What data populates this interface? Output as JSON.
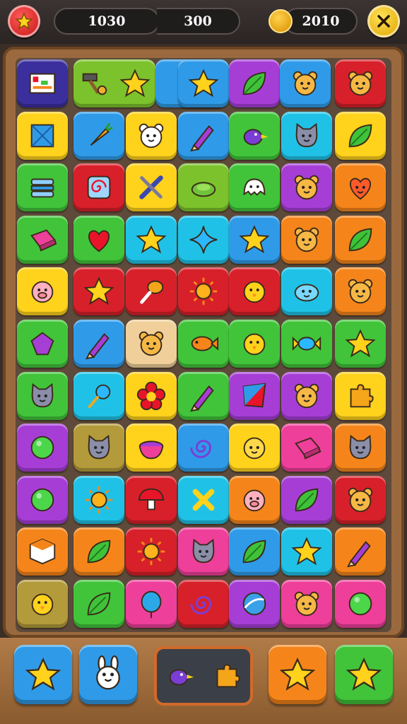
{
  "hud": {
    "score": "1030",
    "moves": "300",
    "coins": "2010",
    "star_button": "star-icon",
    "close_button": "close-icon"
  },
  "colors": {
    "navy": "#3b2f9e",
    "lime": "#7cc22c",
    "blue": "#2f9be8",
    "purple": "#a63ed6",
    "red": "#d8202a",
    "yellow": "#ffd21c",
    "orange": "#f5851a",
    "green": "#41c43a",
    "cyan": "#1fc2e6",
    "pink": "#ee3f9a",
    "olive": "#b39a3a",
    "tan": "#f0cf9a"
  },
  "grid": {
    "rows": [
      [
        [
          "navy",
          "toy-box-icon"
        ],
        [
          "lime",
          "hammer-icon"
        ],
        [
          "lime",
          "star-icon"
        ],
        [
          "blue",
          "cherry-icon"
        ],
        [
          "blue",
          "star-icon"
        ],
        [
          "purple",
          "leaf-icon"
        ],
        [
          "blue",
          "bear-icon"
        ],
        [
          "red",
          "bear-icon"
        ]
      ],
      [
        [
          "yellow",
          "box-icon"
        ],
        [
          "blue",
          "carrot-icon"
        ],
        [
          "yellow",
          "polar-bear-icon"
        ],
        [
          "blue",
          "crayon-icon"
        ],
        [
          "green",
          "bird-icon"
        ],
        [
          "cyan",
          "cat-icon"
        ],
        [
          "yellow",
          "leaf-icon"
        ]
      ],
      [
        [
          "green",
          "sandwich-icon"
        ],
        [
          "red",
          "swirl-candy-icon"
        ],
        [
          "yellow",
          "wrench-icon"
        ],
        [
          "lime",
          "turtle-icon"
        ],
        [
          "green",
          "ghost-icon"
        ],
        [
          "purple",
          "bear-icon"
        ],
        [
          "orange",
          "heart-face-icon"
        ]
      ],
      [
        [
          "green",
          "eraser-icon"
        ],
        [
          "green",
          "heart-icon"
        ],
        [
          "cyan",
          "star-icon"
        ],
        [
          "cyan",
          "sparkle-icon"
        ],
        [
          "blue",
          "star-icon"
        ],
        [
          "orange",
          "bear-icon"
        ],
        [
          "orange",
          "leaf-icon"
        ]
      ],
      [
        [
          "yellow",
          "pig-icon"
        ],
        [
          "red",
          "star-icon"
        ],
        [
          "red",
          "drumstick-icon"
        ],
        [
          "red",
          "sun-icon"
        ],
        [
          "red",
          "chick-icon"
        ],
        [
          "cyan",
          "blob-icon"
        ],
        [
          "orange",
          "bear-icon"
        ]
      ],
      [
        [
          "green",
          "gem-icon"
        ],
        [
          "blue",
          "crayon-icon"
        ],
        [
          "tan",
          "bear-icon"
        ],
        [
          "green",
          "fish-icon"
        ],
        [
          "green",
          "chick-icon"
        ],
        [
          "green",
          "candy-icon"
        ],
        [
          "green",
          "star-icon"
        ]
      ],
      [
        [
          "green",
          "cat-icon"
        ],
        [
          "cyan",
          "lollipop-icon"
        ],
        [
          "yellow",
          "flower-icon"
        ],
        [
          "green",
          "crayon-icon"
        ],
        [
          "purple",
          "flag-icon"
        ],
        [
          "purple",
          "bear-icon"
        ],
        [
          "yellow",
          "puzzle-icon"
        ]
      ],
      [
        [
          "purple",
          "orb-icon"
        ],
        [
          "olive",
          "cat-icon"
        ],
        [
          "yellow",
          "bowl-icon"
        ],
        [
          "blue",
          "swirl-icon"
        ],
        [
          "yellow",
          "smile-icon"
        ],
        [
          "pink",
          "eraser-icon"
        ],
        [
          "orange",
          "cat-icon"
        ]
      ],
      [
        [
          "purple",
          "orb-icon"
        ],
        [
          "cyan",
          "sun-icon"
        ],
        [
          "red",
          "mushroom-icon"
        ],
        [
          "cyan",
          "cross-icon"
        ],
        [
          "orange",
          "pig-icon"
        ],
        [
          "purple",
          "leaf-icon"
        ],
        [
          "red",
          "bear-icon"
        ]
      ],
      [
        [
          "orange",
          "cube-icon"
        ],
        [
          "orange",
          "leaf-icon"
        ],
        [
          "red",
          "sun-icon"
        ],
        [
          "pink",
          "cat-icon"
        ],
        [
          "blue",
          "leaf-icon"
        ],
        [
          "cyan",
          "star-icon"
        ],
        [
          "orange",
          "crayon-icon"
        ]
      ],
      [
        [
          "olive",
          "chick-icon"
        ],
        [
          "green",
          "leaf-icon"
        ],
        [
          "pink",
          "balloon-icon"
        ],
        [
          "red",
          "swirl-icon"
        ],
        [
          "purple",
          "ball-icon"
        ],
        [
          "pink",
          "bear-icon"
        ],
        [
          "pink",
          "orb-icon"
        ]
      ]
    ]
  },
  "boosters": [
    [
      "blue",
      "star-icon"
    ],
    [
      "blue",
      "bunny-icon"
    ],
    [
      "slot",
      "bird-icon",
      "puzzle-icon"
    ],
    [
      "orange",
      "star-icon"
    ],
    [
      "green",
      "star-icon"
    ]
  ]
}
